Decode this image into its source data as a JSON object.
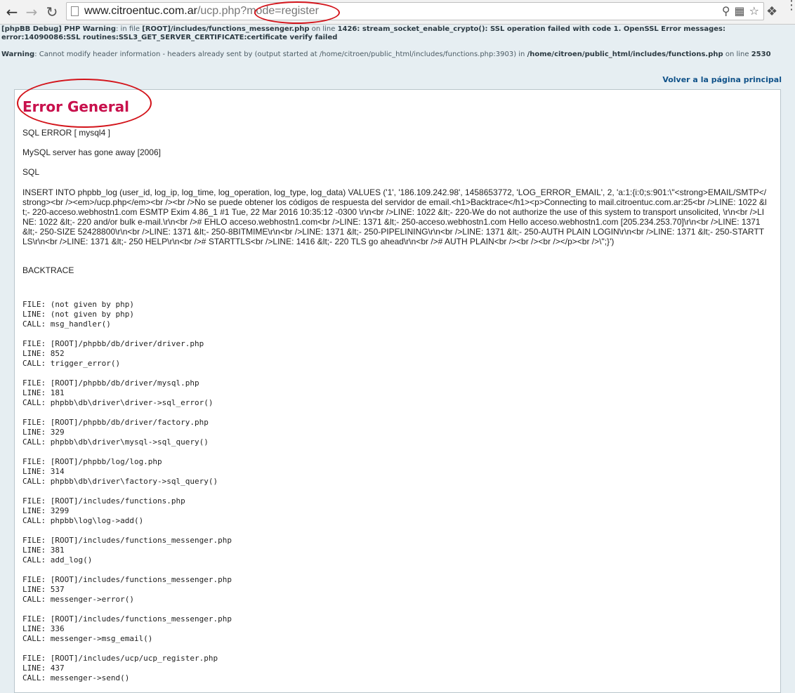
{
  "browser": {
    "url_host": "www.citroentuc.com.ar",
    "url_path": "/ucp.php?mode=register",
    "back_icon": "arrow-left-icon",
    "forward_icon": "arrow-right-icon",
    "reload_icon": "reload-icon"
  },
  "warnings": {
    "line1_prefix": "[phpBB Debug] PHP Warning",
    "line1_mid": ": in file ",
    "line1_file": "[ROOT]/includes/functions_messenger.php",
    "line1_online": " on line ",
    "line1_line": "1426",
    "line1_msg": ": stream_socket_enable_crypto(): SSL operation failed with code 1. OpenSSL Error messages:",
    "line2": "error:14090086:SSL routines:SSL3_GET_SERVER_CERTIFICATE:certificate verify failed",
    "line3_prefix": "Warning",
    "line3_msg": ": Cannot modify header information - headers already sent by (output started at /home/citroen/public_html/includes/functions.php:3903) in ",
    "line3_file": "/home/citroen/public_html/includes/functions.php",
    "line3_online": " on line ",
    "line3_line": "2530"
  },
  "back_link": "Volver a la página principal",
  "error": {
    "title": "Error General",
    "sql_error": "SQL ERROR [ mysql4 ]",
    "server_msg": "MySQL server has gone away [2006]",
    "sql_label": "SQL",
    "sql_query": "INSERT INTO phpbb_log (user_id, log_ip, log_time, log_operation, log_type, log_data) VALUES ('1', '186.109.242.98', 1458653772, 'LOG_ERROR_EMAIL', 2, 'a:1:{i:0;s:901:\\\"<strong>EMAIL/SMTP</strong><br /><em>/ucp.php</em><br /><br />No se puede obtener los códigos de respuesta del servidor de email.<h1>Backtrace</h1><p>Connecting to mail.citroentuc.com.ar:25<br />LINE: 1022 &lt;- 220-acceso.webhostn1.com ESMTP Exim 4.86_1 #1 Tue, 22 Mar 2016 10:35:12 -0300 \\r\\n<br />LINE: 1022 &lt;- 220-We do not authorize the use of this system to transport unsolicited, \\r\\n<br />LINE: 1022 &lt;- 220 and/or bulk e-mail.\\r\\n<br /># EHLO acceso.webhostn1.com<br />LINE: 1371 &lt;- 250-acceso.webhostn1.com Hello acceso.webhostn1.com [205.234.253.70]\\r\\n<br />LINE: 1371 &lt;- 250-SIZE 52428800\\r\\n<br />LINE: 1371 &lt;- 250-8BITMIME\\r\\n<br />LINE: 1371 &lt;- 250-PIPELINING\\r\\n<br />LINE: 1371 &lt;- 250-AUTH PLAIN LOGIN\\r\\n<br />LINE: 1371 &lt;- 250-STARTTLS\\r\\n<br />LINE: 1371 &lt;- 250 HELP\\r\\n<br /># STARTTLS<br />LINE: 1416 &lt;- 220 TLS go ahead\\r\\n<br /># AUTH PLAIN<br /><br /><br /></p><br />\\\";}')",
    "backtrace_label": "BACKTRACE",
    "trace": [
      {
        "file": "FILE: (not given by php)",
        "line": "LINE: (not given by php)",
        "call": "CALL: msg_handler()"
      },
      {
        "file": "FILE: [ROOT]/phpbb/db/driver/driver.php",
        "line": "LINE: 852",
        "call": "CALL: trigger_error()"
      },
      {
        "file": "FILE: [ROOT]/phpbb/db/driver/mysql.php",
        "line": "LINE: 181",
        "call": "CALL: phpbb\\db\\driver\\driver->sql_error()"
      },
      {
        "file": "FILE: [ROOT]/phpbb/db/driver/factory.php",
        "line": "LINE: 329",
        "call": "CALL: phpbb\\db\\driver\\mysql->sql_query()"
      },
      {
        "file": "FILE: [ROOT]/phpbb/log/log.php",
        "line": "LINE: 314",
        "call": "CALL: phpbb\\db\\driver\\factory->sql_query()"
      },
      {
        "file": "FILE: [ROOT]/includes/functions.php",
        "line": "LINE: 3299",
        "call": "CALL: phpbb\\log\\log->add()"
      },
      {
        "file": "FILE: [ROOT]/includes/functions_messenger.php",
        "line": "LINE: 381",
        "call": "CALL: add_log()"
      },
      {
        "file": "FILE: [ROOT]/includes/functions_messenger.php",
        "line": "LINE: 537",
        "call": "CALL: messenger->error()"
      },
      {
        "file": "FILE: [ROOT]/includes/functions_messenger.php",
        "line": "LINE: 336",
        "call": "CALL: messenger->msg_email()"
      },
      {
        "file": "FILE: [ROOT]/includes/ucp/ucp_register.php",
        "line": "LINE: 437",
        "call": "CALL: messenger->send()"
      }
    ]
  },
  "colors": {
    "title": "#c8104c",
    "annotation": "#d3141b",
    "link": "#105289",
    "page_bg": "#e6eef2"
  }
}
